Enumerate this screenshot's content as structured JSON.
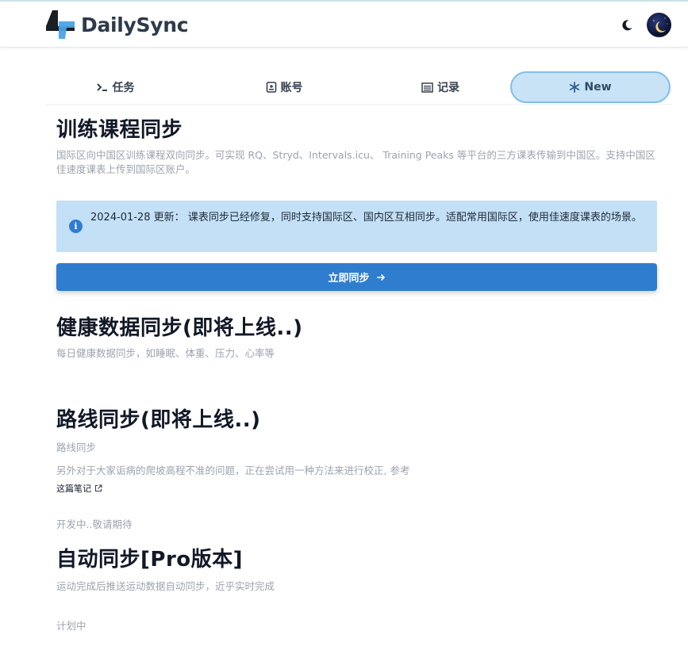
{
  "header": {
    "brand": "DailySync",
    "theme_icon": "moon-icon",
    "avatar_icon": "avatar-moon-icon"
  },
  "tabs": [
    {
      "label": "任务",
      "icon": "terminal-icon"
    },
    {
      "label": "账号",
      "icon": "id-card-icon"
    },
    {
      "label": "记录",
      "icon": "list-icon"
    },
    {
      "label": "New",
      "icon": "snowflake-icon",
      "active": true
    }
  ],
  "training": {
    "title": "训练课程同步",
    "description": "国际区向中国区训练课程双向同步。可实现 RQ、Stryd、Intervals.icu、 Training Peaks 等平台的三方课表传输到中国区。支持中国区佳速度课表上传到国际区账户。",
    "notice": "2024-01-28 更新： 课表同步已经修复，同时支持国际区、国内区互相同步。适配常用国际区，使用佳速度课表的场景。",
    "button_label": "立即同步",
    "button_icon": "arrow-right-icon"
  },
  "health": {
    "title": "健康数据同步(即将上线..)",
    "description": "每日健康数据同步，如睡眠、体重、压力、心率等"
  },
  "route": {
    "title": "路线同步(即将上线..)",
    "subtitle": "路线同步",
    "description": "另外对于大家诟病的爬坡高程不准的问题，正在尝试用一种方法来进行校正, 参考",
    "link_label": "这篇笔记",
    "link_icon": "external-link-icon",
    "status": "开发中..敬请期待"
  },
  "auto": {
    "title": "自动同步[Pro版本]",
    "description": "运动完成后推送运动数据自动同步，近乎实时完成",
    "status": "计划中"
  },
  "colors": {
    "accent": "#2f7dce",
    "notice_bg": "#c3e0f6",
    "active_tab_bg": "#c8e2f6"
  }
}
